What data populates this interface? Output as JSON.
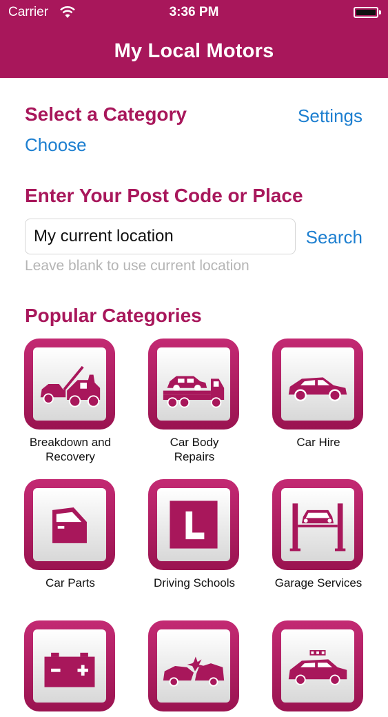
{
  "status_bar": {
    "carrier": "Carrier",
    "time": "3:36 PM"
  },
  "nav": {
    "title": "My Local Motors"
  },
  "category": {
    "heading": "Select a Category",
    "settings_label": "Settings",
    "choose_label": "Choose"
  },
  "location": {
    "heading": "Enter Your Post Code or Place",
    "input_value": "My current location",
    "search_label": "Search",
    "hint": "Leave blank to use current location"
  },
  "popular": {
    "heading": "Popular Categories",
    "items": [
      {
        "label": "Breakdown and Recovery",
        "icon": "tow-truck-icon"
      },
      {
        "label": "Car Body Repairs",
        "icon": "flatbed-truck-icon"
      },
      {
        "label": "Car Hire",
        "icon": "car-icon"
      },
      {
        "label": "Car Parts",
        "icon": "car-door-icon"
      },
      {
        "label": "Driving Schools",
        "icon": "learner-plate-icon"
      },
      {
        "label": "Garage Services",
        "icon": "car-lift-icon"
      },
      {
        "label": "",
        "icon": "battery-icon"
      },
      {
        "label": "",
        "icon": "car-crash-icon"
      },
      {
        "label": "",
        "icon": "taxi-icon"
      }
    ]
  },
  "colors": {
    "brand": "#a8175b",
    "link": "#1d7fd0",
    "hint": "#b5b5b5"
  }
}
